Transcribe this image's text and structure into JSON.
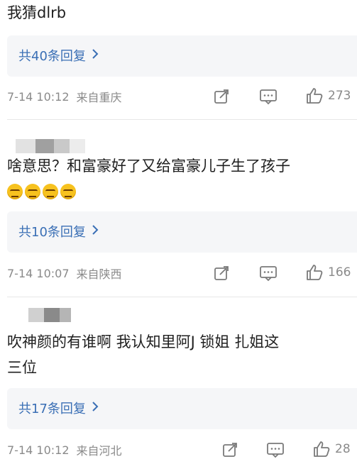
{
  "comments": [
    {
      "text": "我猜dlrb",
      "replies": "共40条回复",
      "time": "7-14 10:12",
      "location": "来自重庆",
      "likes": "273"
    },
    {
      "text": "啥意思？和富豪好了又给富豪儿子生了孩子",
      "emojis": [
        "persevere-face-icon",
        "persevere-face-icon",
        "persevere-face-icon",
        "persevere-face-icon"
      ],
      "replies": "共10条回复",
      "time": "7-14 10:07",
      "location": "来自陕西",
      "likes": "166"
    },
    {
      "text_line1": "吹神颜的有谁啊 我认知里阿J 锁姐 扎姐这",
      "text_line2": "三位",
      "replies": "共17条回复",
      "time": "7-14 10:12",
      "location": "来自河北",
      "likes": "28"
    }
  ],
  "icons": {
    "share": "share-icon",
    "comment": "comment-icon",
    "like": "thumbs-up-icon",
    "chevron": "chevron-right-icon"
  },
  "colors": {
    "link": "#3a6fb5",
    "meta": "#8a8a8a",
    "reply_bg": "#f5f6f8"
  }
}
